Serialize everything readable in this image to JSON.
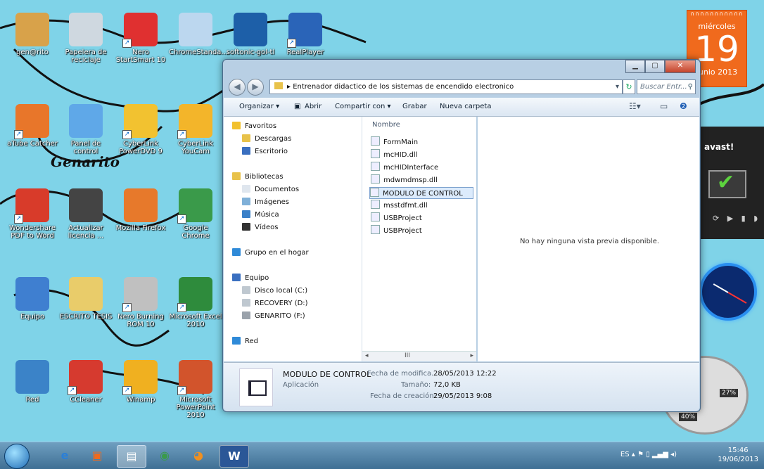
{
  "desktop": {
    "icons": [
      {
        "label": "gen@rito",
        "icon": "user-folder-icon",
        "color": "#d8a24a",
        "shortcut": false
      },
      {
        "label": "Papelera de reciclaje",
        "icon": "recycle-bin-icon",
        "color": "#cfd8e0",
        "shortcut": false
      },
      {
        "label": "Nero StartSmart 10",
        "icon": "nero-icon",
        "color": "#e03030",
        "shortcut": true
      },
      {
        "label": "ChromeStanda...",
        "icon": "installer-icon",
        "color": "#bcd7ef",
        "shortcut": false
      },
      {
        "label": "softonic-gol-tl",
        "icon": "softonic-icon",
        "color": "#1d5fa8",
        "shortcut": false
      },
      {
        "label": "RealPlayer",
        "icon": "realplayer-icon",
        "color": "#2a64b8",
        "shortcut": true
      },
      {
        "label": "aTube Catcher",
        "icon": "atube-icon",
        "color": "#e8762a",
        "shortcut": true
      },
      {
        "label": "Panel de control",
        "icon": "control-panel-icon",
        "color": "#5fa8e8",
        "shortcut": false
      },
      {
        "label": "CyberLink PowerDVD 9",
        "icon": "powerdvd-icon",
        "color": "#f2c230",
        "shortcut": true
      },
      {
        "label": "CyberLink YouCam",
        "icon": "youcam-icon",
        "color": "#f3b52a",
        "shortcut": true
      },
      {
        "label": "Wondershare PDF to Word",
        "icon": "pdf-icon",
        "color": "#d83b2a",
        "shortcut": true
      },
      {
        "label": "Actualizar licencia ...",
        "icon": "license-icon",
        "color": "#444444",
        "shortcut": false
      },
      {
        "label": "Mozilla Firefox",
        "icon": "firefox-icon",
        "color": "#e7792b",
        "shortcut": false
      },
      {
        "label": "Google Chrome",
        "icon": "chrome-icon",
        "color": "#3a9a4a",
        "shortcut": true
      },
      {
        "label": "Equipo",
        "icon": "computer-icon",
        "color": "#3f7fd0",
        "shortcut": false
      },
      {
        "label": "ESCRITO TESIS",
        "icon": "folder-icon",
        "color": "#e9cc6a",
        "shortcut": false
      },
      {
        "label": "Nero Burning ROM 10",
        "icon": "nero-burning-icon",
        "color": "#c0c0c0",
        "shortcut": true
      },
      {
        "label": "Microsoft Excel 2010",
        "icon": "excel-icon",
        "color": "#2e8b3c",
        "shortcut": true
      },
      {
        "label": "Red",
        "icon": "network-icon",
        "color": "#3b83c8",
        "shortcut": false
      },
      {
        "label": "CCleaner",
        "icon": "ccleaner-icon",
        "color": "#d63a2f",
        "shortcut": true
      },
      {
        "label": "Winamp",
        "icon": "winamp-icon",
        "color": "#f0b020",
        "shortcut": true
      },
      {
        "label": "Microsoft PowerPoint 2010",
        "icon": "powerpoint-icon",
        "color": "#d2542c",
        "shortcut": true
      }
    ],
    "handwriting": "Genarito"
  },
  "gadgets": {
    "calendar": {
      "weekday": "miércoles",
      "day": "19",
      "month_year": "junio 2013"
    },
    "avast": {
      "logo": "avast!"
    },
    "cpu_meter": {
      "value_a": "27%",
      "value_b": "40%"
    }
  },
  "explorer": {
    "path": "Entrenador didactico de los sistemas de encendido electronico",
    "search_placeholder": "Buscar Entr...",
    "toolbar": {
      "organize": "Organizar ▾",
      "open": "Abrir",
      "share": "Compartir con ▾",
      "burn": "Grabar",
      "new_folder": "Nueva carpeta"
    },
    "nav": [
      {
        "label": "Favoritos",
        "icon": "star-icon",
        "color": "#f2c12e",
        "indent": 0
      },
      {
        "label": "Descargas",
        "icon": "downloads-icon",
        "color": "#e8c24a",
        "indent": 1
      },
      {
        "label": "Escritorio",
        "icon": "desktop-icon",
        "color": "#3a6fc0",
        "indent": 1
      },
      {
        "label": "Bibliotecas",
        "icon": "libraries-icon",
        "color": "#e8c24a",
        "indent": 0
      },
      {
        "label": "Documentos",
        "icon": "documents-icon",
        "color": "#dfe6ee",
        "indent": 1
      },
      {
        "label": "Imágenes",
        "icon": "images-icon",
        "color": "#7fb0d8",
        "indent": 1
      },
      {
        "label": "Música",
        "icon": "music-icon",
        "color": "#3a80c8",
        "indent": 1
      },
      {
        "label": "Vídeos",
        "icon": "videos-icon",
        "color": "#333333",
        "indent": 1
      },
      {
        "label": "Grupo en el hogar",
        "icon": "homegroup-icon",
        "color": "#2f8ad8",
        "indent": 0
      },
      {
        "label": "Equipo",
        "icon": "computer-icon",
        "color": "#3a6fc0",
        "indent": 0
      },
      {
        "label": "Disco local (C:)",
        "icon": "drive-c-icon",
        "color": "#bfc8d0",
        "indent": 1
      },
      {
        "label": "RECOVERY (D:)",
        "icon": "drive-d-icon",
        "color": "#bfc8d0",
        "indent": 1
      },
      {
        "label": "GENARITO (F:)",
        "icon": "usb-drive-icon",
        "color": "#9aa2ab",
        "indent": 1
      },
      {
        "label": "Red",
        "icon": "network-icon",
        "color": "#2f8ad8",
        "indent": 0
      }
    ],
    "files_header": "Nombre",
    "files": [
      {
        "name": "FormMain",
        "icon": "app-window-icon",
        "selected": false
      },
      {
        "name": "mcHID.dll",
        "icon": "dll-icon",
        "selected": false
      },
      {
        "name": "mcHIDInterface",
        "icon": "component-icon",
        "selected": false
      },
      {
        "name": "mdwmdmsp.dll",
        "icon": "dll-icon",
        "selected": false
      },
      {
        "name": "MODULO DE CONTROL",
        "icon": "app-window-icon",
        "selected": true
      },
      {
        "name": "msstdfmt.dll",
        "icon": "dll-icon",
        "selected": false
      },
      {
        "name": "USBProject",
        "icon": "vb-project-icon",
        "selected": false
      },
      {
        "name": "USBProject",
        "icon": "blank-file-icon",
        "selected": false
      }
    ],
    "preview_text": "No hay ninguna vista previa disponible.",
    "details": {
      "name": "MODULO DE CONTROL",
      "type": "Aplicación",
      "modified_label": "Fecha de modifica...",
      "modified_value": "28/05/2013 12:22",
      "size_label": "Tamaño:",
      "size_value": "72,0 KB",
      "created_label": "Fecha de creación:",
      "created_value": "29/05/2013 9:08"
    }
  },
  "taskbar": {
    "lang": "ES",
    "time": "15:46",
    "date": "19/06/2013"
  }
}
